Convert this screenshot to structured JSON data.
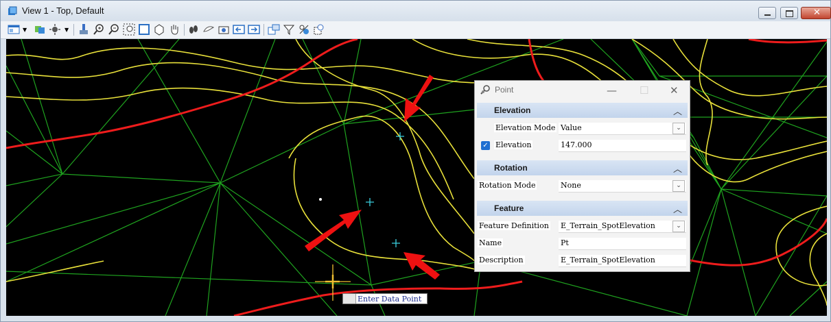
{
  "window": {
    "title": "View 1 - Top, Default",
    "controls": [
      "minimize-icon",
      "restore-icon",
      "close-icon"
    ]
  },
  "toolbar": {
    "icons": [
      "view-attributes-icon",
      "display-style-icon",
      "lighting-icon",
      "update-view-icon",
      "zoom-in-icon",
      "zoom-out-icon",
      "window-area-icon",
      "fit-view-icon",
      "rotate-view-icon",
      "pan-view-icon",
      "walk-icon",
      "view-previous-icon",
      "view-next-icon",
      "copy-view-icon",
      "clip-volume-icon",
      "clip-mask-icon",
      "section-icon",
      "more-icon"
    ]
  },
  "prompt": {
    "text": "Enter Data Point"
  },
  "dialog": {
    "title": "Point",
    "sections": {
      "elevation": {
        "label": "Elevation",
        "rows": {
          "mode": {
            "label": "Elevation Mode",
            "value": "Value"
          },
          "elevation": {
            "label": "Elevation",
            "value": "147.000",
            "checked": true
          }
        }
      },
      "rotation": {
        "label": "Rotation",
        "rows": {
          "mode": {
            "label": "Rotation Mode",
            "value": "None"
          }
        }
      },
      "feature": {
        "label": "Feature",
        "rows": {
          "definition": {
            "label": "Feature Definition",
            "value": "E_Terrain_SpotElevation"
          },
          "name": {
            "label": "Name",
            "value": "Pt"
          },
          "description": {
            "label": "Description",
            "value": "E_Terrain_SpotElevation"
          }
        }
      }
    }
  },
  "colors": {
    "canvas_bg": "#000000",
    "triangle_edges": "#1fa31f",
    "contours_minor": "#e8e03a",
    "contours_major": "#ee1c1c",
    "cursor": "#f0c030",
    "point_markers": "#3ad0e0",
    "annotation_arrows": "#ee1111",
    "section_header": "#c8d8ef"
  }
}
